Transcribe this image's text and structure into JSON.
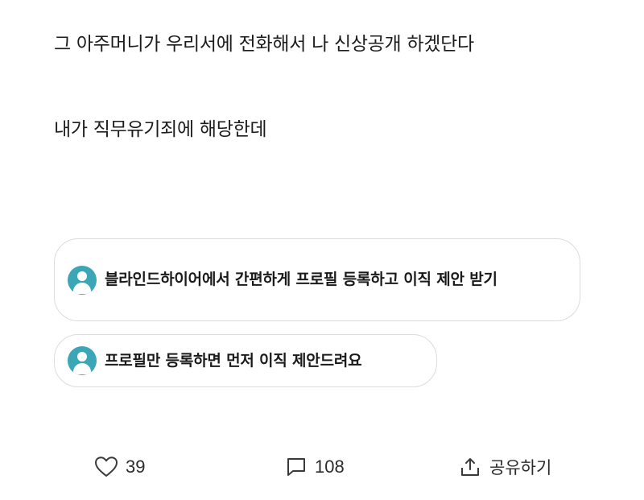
{
  "post": {
    "line1": "그 아주머니가 우리서에 전화해서 나 신상공개 하겠단다",
    "line2": "내가 직무유기죄에 해당한데"
  },
  "promos": [
    {
      "text": "블라인드하이어에서 간편하게 프로필 등록하고 이직 제안 받기",
      "icon": "user-avatar-icon"
    },
    {
      "text": "프로필만 등록하면 먼저 이직 제안드려요",
      "icon": "user-avatar-icon"
    }
  ],
  "actions": {
    "like": {
      "icon": "heart-icon",
      "count": "39"
    },
    "comment": {
      "icon": "comment-icon",
      "count": "108"
    },
    "share": {
      "icon": "share-icon",
      "label": "공유하기"
    }
  },
  "colors": {
    "accent": "#3aa6b6",
    "border": "#dcdcdc",
    "text": "#1a1a1a"
  }
}
